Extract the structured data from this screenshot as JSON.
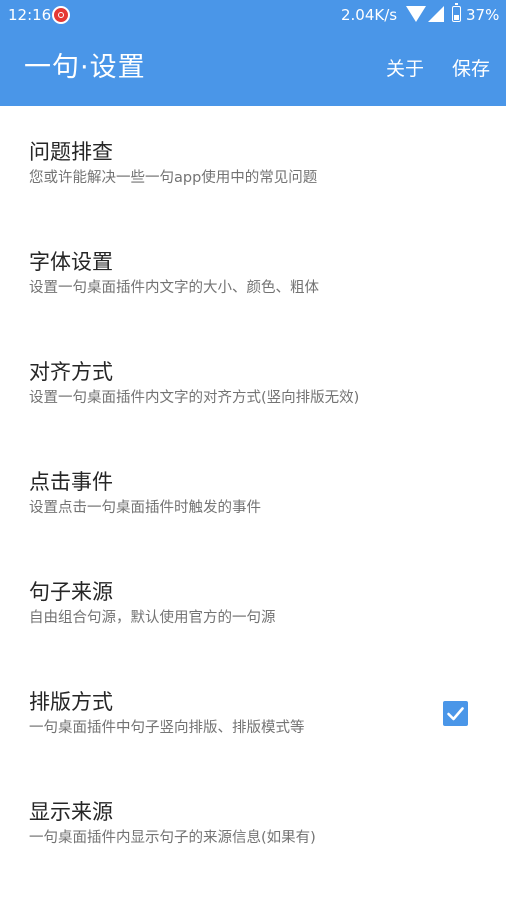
{
  "status_bar": {
    "time": "12:16",
    "net_speed": "2.04K/s",
    "battery": "37%",
    "icons": [
      "notification-app-icon",
      "wifi-icon",
      "signal-icon",
      "battery-icon"
    ]
  },
  "app_bar": {
    "title": "一句·设置",
    "about_label": "关于",
    "save_label": "保存",
    "color": "#4a96e8"
  },
  "settings": {
    "items": [
      {
        "title": "问题排查",
        "subtitle": "您或许能解决一些一句app使用中的常见问题"
      },
      {
        "title": "字体设置",
        "subtitle": "设置一句桌面插件内文字的大小、颜色、粗体"
      },
      {
        "title": "对齐方式",
        "subtitle": "设置一句桌面插件内文字的对齐方式(竖向排版无效)"
      },
      {
        "title": "点击事件",
        "subtitle": "设置点击一句桌面插件时触发的事件"
      },
      {
        "title": "句子来源",
        "subtitle": "自由组合句源，默认使用官方的一句源"
      },
      {
        "title": "排版方式",
        "subtitle": "一句桌面插件中句子竖向排版、排版模式等"
      },
      {
        "title": "显示来源",
        "subtitle": "一句桌面插件内显示句子的来源信息(如果有)",
        "checked": true
      }
    ]
  }
}
